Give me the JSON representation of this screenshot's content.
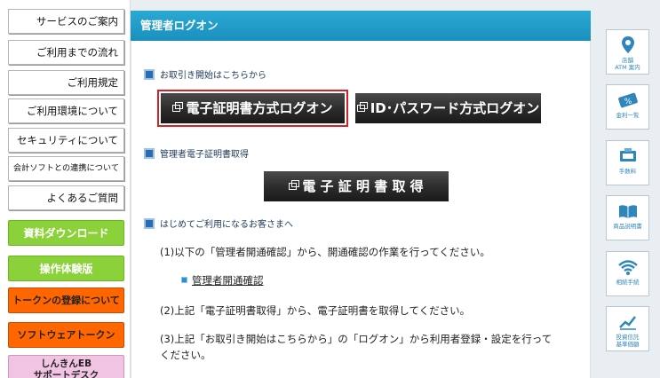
{
  "sidebar": {
    "items": [
      {
        "label": "サービスのご案内"
      },
      {
        "label": "ご利用までの流れ"
      },
      {
        "label": "ご利用規定"
      },
      {
        "label": "ご利用環境について"
      },
      {
        "label": "セキュリティについて"
      },
      {
        "label": "会計ソフトとの連携について"
      },
      {
        "label": "よくあるご質問"
      }
    ],
    "buttons": [
      {
        "label": "資料ダウンロード"
      },
      {
        "label": "操作体験版"
      },
      {
        "label": "トークンの登録について"
      },
      {
        "label": "ソフトウェアトークン"
      },
      {
        "label": "しんきんEB",
        "label2": "サポートデスク"
      }
    ]
  },
  "main": {
    "title": "管理者ログオン",
    "section1": {
      "heading": "お取引き開始はこちらから",
      "cert_logon": "電子証明書方式ログオン",
      "id_logon": "ID･パスワード方式ログオン"
    },
    "section2": {
      "heading": "管理者電子証明書取得",
      "cert_get": "電 子 証 明 書 取 得"
    },
    "section3": {
      "heading": "はじめてご利用になるお客さまへ",
      "step1": "(1)以下の「管理者開通確認」から、開通確認の作業を行ってください。",
      "link": "管理者開通確認",
      "step2": "(2)上記「電子証明書取得」から、電子証明書を取得してください。",
      "step3_line1": "(3)上記「お取引き開始はこちらから」の「ログオン」から利用者登録・設定を行って",
      "step3_line2": "ください。"
    }
  },
  "rail": {
    "items": [
      {
        "label": "店舗",
        "label2": "ATM 案内",
        "icon": "map-pin-icon"
      },
      {
        "label": "金利一覧",
        "icon": "percent-icon"
      },
      {
        "label": "手数料",
        "icon": "fee-icon"
      },
      {
        "label": "商品説明書",
        "icon": "book-icon"
      },
      {
        "label": "相続手続",
        "icon": "wifi-icon"
      },
      {
        "label": "投資信託",
        "label2": "基準価額",
        "icon": "chart-icon"
      }
    ]
  },
  "colors": {
    "header": "#1f9cc9",
    "selected_border": "#d42027",
    "green": "#8bd23a",
    "orange": "#ff6600",
    "pink": "#f2c4e4"
  }
}
